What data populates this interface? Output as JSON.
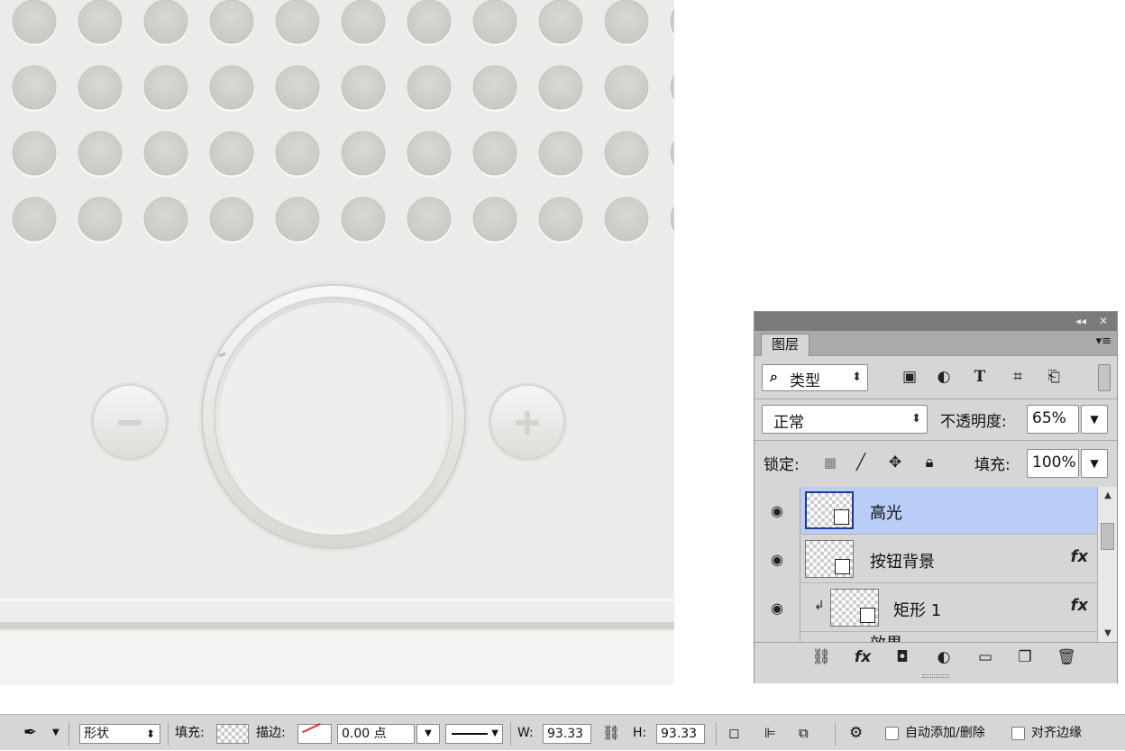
{
  "colors": {
    "canvas_bg": "#ecebe9",
    "selection": "#b9cdf6",
    "panel_bg": "#d6d6d6"
  },
  "canvas": {
    "minus_symbol": "−",
    "plus_symbol": "+"
  },
  "layers_panel": {
    "collapse_label": "◂◂",
    "close_label": "✕",
    "tab": "图层",
    "menu_icon": "▾≡",
    "filter": {
      "prefix_icon": "⌕",
      "value": "类型",
      "icons": [
        "image-filter-icon",
        "adjustment-filter-icon",
        "type-filter-icon",
        "shape-filter-icon",
        "smart-object-filter-icon"
      ]
    },
    "blend_mode": "正常",
    "opacity_label": "不透明度:",
    "opacity_value": "65%",
    "lock_label": "锁定:",
    "fill_label": "填充:",
    "fill_value": "100%",
    "layers": [
      {
        "name": "高光",
        "selected": true,
        "fx": ""
      },
      {
        "name": "按钮背景",
        "selected": false,
        "fx": "fx"
      },
      {
        "name": "矩形 1",
        "selected": false,
        "fx": "fx",
        "clipped": true
      },
      {
        "name": "效果",
        "selected": false,
        "fx": ""
      }
    ]
  },
  "options_bar": {
    "mode": "形状",
    "fill_label": "填充:",
    "stroke_label": "描边:",
    "stroke_width": "0.00 点",
    "w_label": "W:",
    "w_value": "93.33",
    "h_label": "H:",
    "h_value": "93.33",
    "auto_add_delete": "自动添加/删除",
    "align_edges": "对齐边缘"
  }
}
